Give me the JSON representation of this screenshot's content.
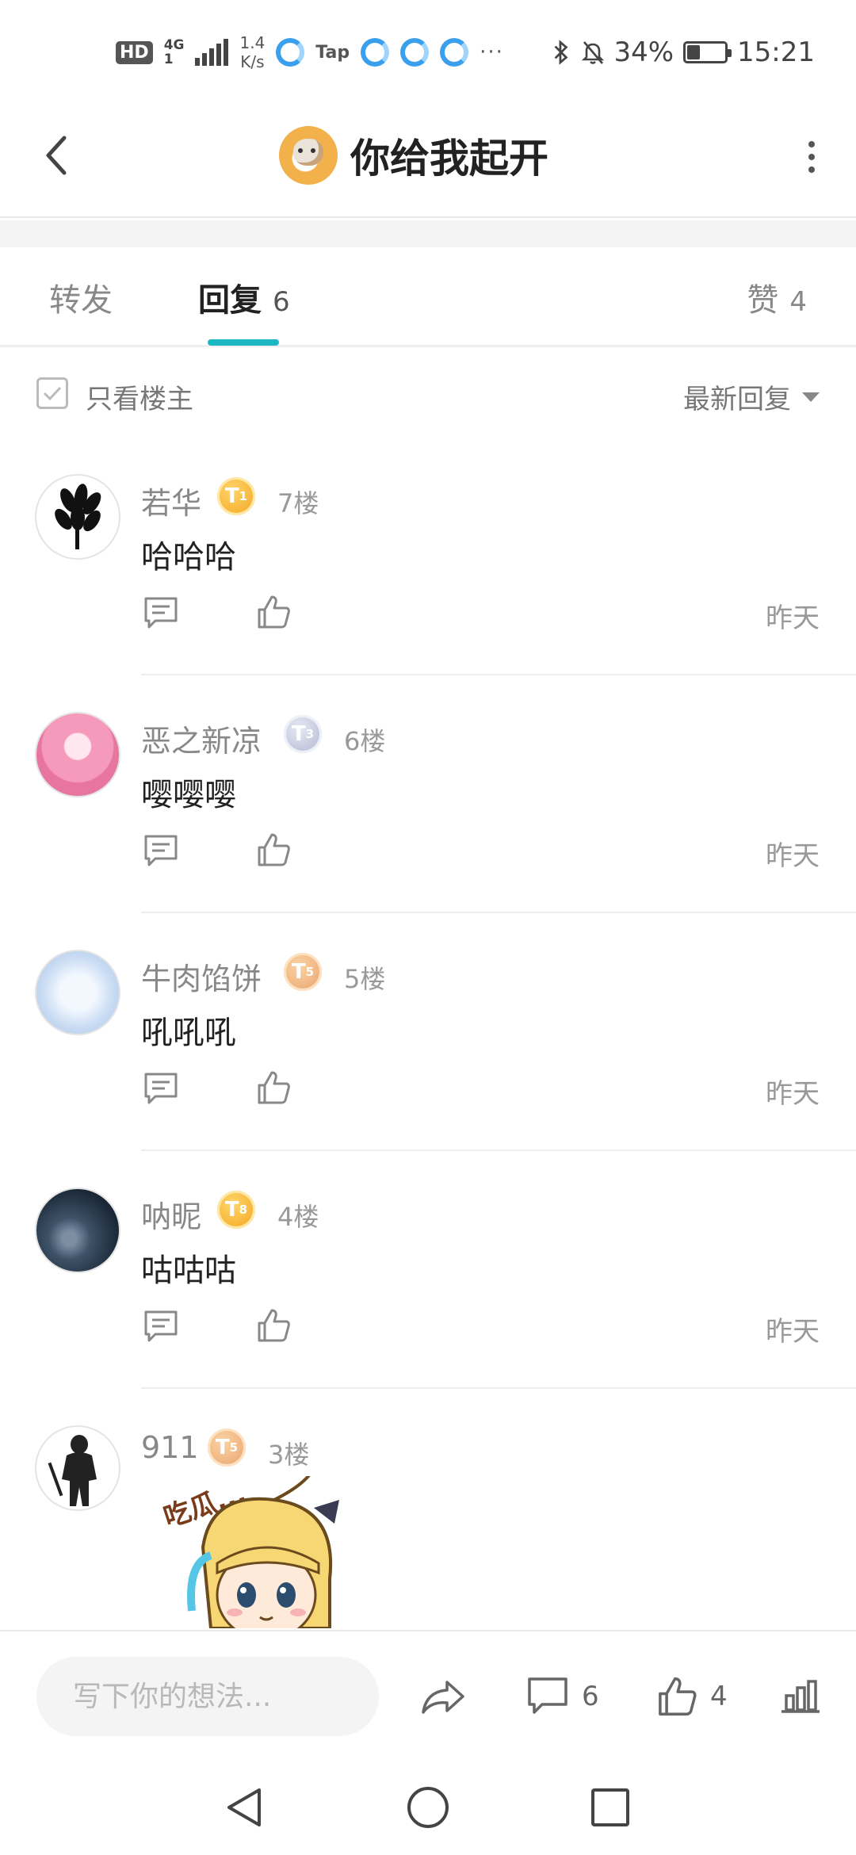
{
  "status_bar": {
    "hd": "HD",
    "network": "4G",
    "network_sub": "1",
    "speed_value": "1.4",
    "speed_unit": "K/s",
    "tap_label": "Tap",
    "more": "···",
    "battery": "34%",
    "time": "15:21"
  },
  "header": {
    "title": "你给我起开"
  },
  "tabs": {
    "repost_label": "转发",
    "reply_label": "回复",
    "reply_count": "6",
    "like_label": "赞",
    "like_count": "4"
  },
  "filter": {
    "only_op_label": "只看楼主",
    "sort_label": "最新回复"
  },
  "comments": [
    {
      "name": "若华",
      "badge": "T",
      "badge_level": "1",
      "badge_tone": "gold",
      "floor": "7楼",
      "text": "哈哈哈",
      "time": "昨天"
    },
    {
      "name": "恶之新凉",
      "badge": "T",
      "badge_level": "3",
      "badge_tone": "silver",
      "floor": "6楼",
      "text": "嘤嘤嘤",
      "time": "昨天"
    },
    {
      "name": "牛肉馅饼",
      "badge": "T",
      "badge_level": "5",
      "badge_tone": "bronze",
      "floor": "5楼",
      "text": "吼吼吼",
      "time": "昨天"
    },
    {
      "name": "呐昵",
      "badge": "T",
      "badge_level": "8",
      "badge_tone": "gold",
      "floor": "4楼",
      "text": "咕咕咕",
      "time": "昨天"
    },
    {
      "name": "911",
      "badge": "T",
      "badge_level": "5",
      "badge_tone": "bronze",
      "floor": "3楼"
    }
  ],
  "sticker": {
    "text": "吃瓜..."
  },
  "bottom_bar": {
    "input_placeholder": "写下你的想法...",
    "comment_count": "6",
    "like_count": "4"
  },
  "colors": {
    "accent": "#1eb7c4",
    "text_primary": "#222222",
    "text_secondary": "#888888"
  }
}
